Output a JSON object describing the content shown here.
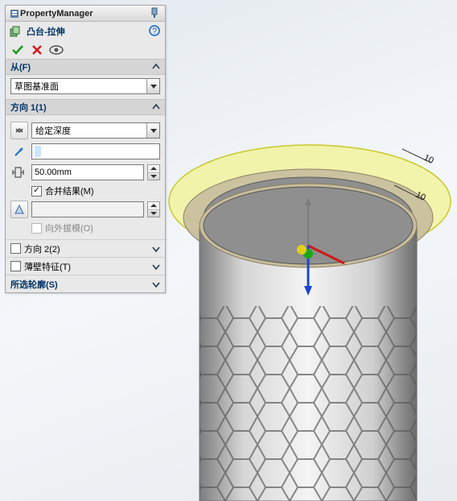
{
  "panel": {
    "title": "PropertyManager",
    "feature": {
      "icon": "boss-extrude-icon",
      "label": "凸台-拉伸"
    },
    "from": {
      "title": "从(F)",
      "start": "草图基准面"
    },
    "dir1": {
      "title": "方向 1(1)",
      "endCondition": "给定深度",
      "distanceValue": "",
      "depth": "50.00mm",
      "mergeLabel": "合并结果(M)",
      "mergeChecked": true,
      "draftField": "",
      "draftOutLabel": "向外拔模(O)",
      "draftOutEnabled": false
    },
    "dir2": {
      "title": "方向 2(2)",
      "enabled": false
    },
    "thin": {
      "title": "薄壁特征(T)",
      "enabled": false
    },
    "sel": {
      "title": "所选轮廓(S)"
    }
  },
  "viewport": {
    "dim1": "10",
    "dim2": "10"
  }
}
